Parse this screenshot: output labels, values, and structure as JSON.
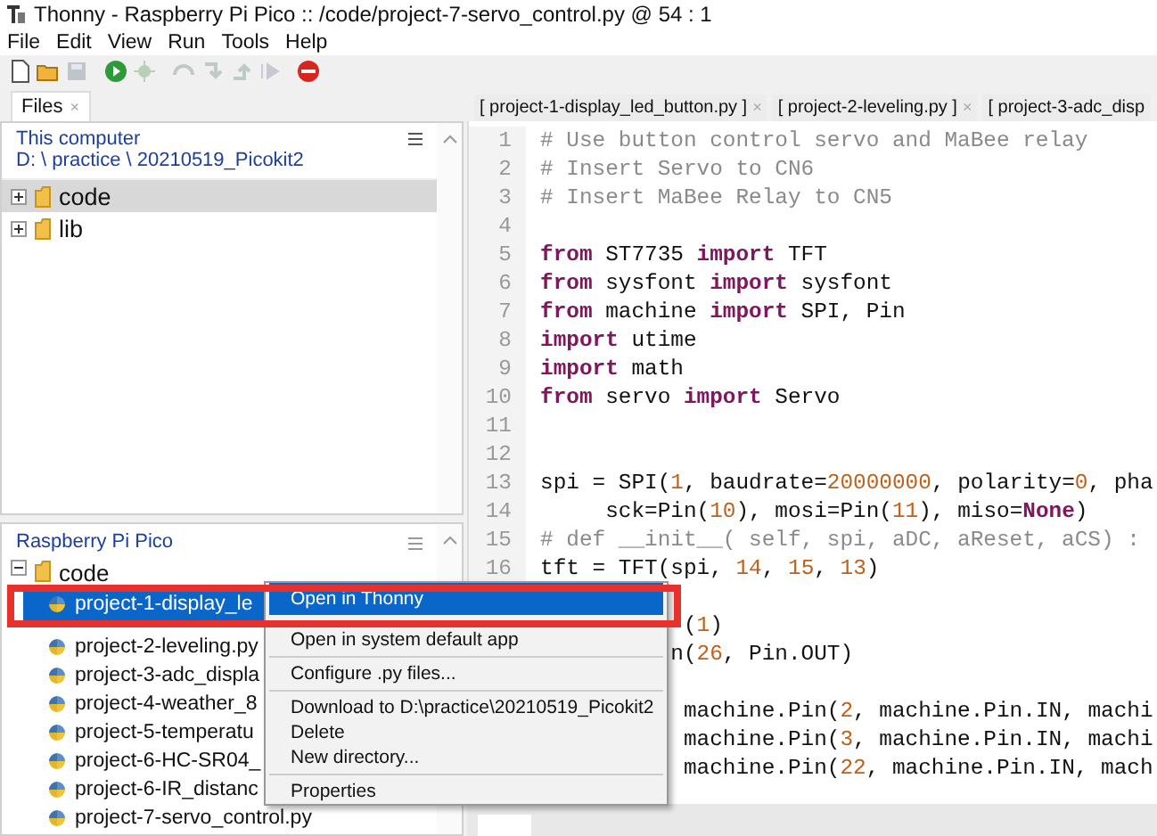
{
  "window": {
    "title": "Thonny  -  Raspberry Pi Pico :: /code/project-7-servo_control.py  @  54 : 1"
  },
  "menu_bar": [
    "File",
    "Edit",
    "View",
    "Run",
    "Tools",
    "Help"
  ],
  "toolbar": [
    {
      "kind": "new",
      "disabled": false
    },
    {
      "kind": "open",
      "disabled": false
    },
    {
      "kind": "save",
      "disabled": true
    },
    {
      "kind": "run",
      "disabled": false
    },
    {
      "kind": "debug",
      "disabled": true
    },
    {
      "kind": "step_over",
      "disabled": true
    },
    {
      "kind": "step_into",
      "disabled": true
    },
    {
      "kind": "step_out",
      "disabled": true
    },
    {
      "kind": "resume",
      "disabled": true
    },
    {
      "kind": "stop",
      "disabled": false
    }
  ],
  "files_tab": {
    "label": "Files",
    "close": "×"
  },
  "local_pane": {
    "title": "This computer",
    "path": "D: \\ practice \\ 20210519_Picokit2",
    "items": [
      {
        "name": "code",
        "expanded": false,
        "selected": true
      },
      {
        "name": "lib",
        "expanded": false,
        "selected": false
      }
    ]
  },
  "device_pane": {
    "title": "Raspberry Pi Pico",
    "folder": {
      "name": "code",
      "expanded": true,
      "selected": false
    },
    "files": [
      {
        "name": "project-1-display_le",
        "selected": true
      },
      {
        "name": "project-2-leveling.py",
        "selected": false
      },
      {
        "name": "project-3-adc_displa",
        "selected": false
      },
      {
        "name": "project-4-weather_8",
        "selected": false
      },
      {
        "name": "project-5-temperatu",
        "selected": false
      },
      {
        "name": "project-6-HC-SR04_",
        "selected": false
      },
      {
        "name": "project-6-IR_distanc",
        "selected": false
      },
      {
        "name": "project-7-servo_control.py",
        "selected": false
      }
    ]
  },
  "editor_tabs": [
    {
      "label": "[ project-1-display_led_button.py ]",
      "close": "×",
      "selected": false
    },
    {
      "label": "[ project-2-leveling.py ]",
      "close": "×",
      "selected": false
    },
    {
      "label": "[ project-3-adc_disp",
      "selected": false
    }
  ],
  "code_lines": [
    {
      "number": "1",
      "segments": [
        {
          "kind": "comment",
          "text": "# Use button control servo and MaBee relay"
        }
      ]
    },
    {
      "number": "2",
      "segments": [
        {
          "kind": "comment",
          "text": "# Insert Servo to CN6"
        }
      ]
    },
    {
      "number": "3",
      "segments": [
        {
          "kind": "comment",
          "text": "# Insert MaBee Relay to CN5"
        }
      ]
    },
    {
      "number": "4"
    },
    {
      "number": "5",
      "segments": [
        {
          "kind": "keyword",
          "text": "from"
        },
        {
          "kind": "plain",
          "text": " ST7735 "
        },
        {
          "kind": "keyword",
          "text": "import"
        },
        {
          "kind": "plain",
          "text": " TFT"
        }
      ]
    },
    {
      "number": "6",
      "segments": [
        {
          "kind": "keyword",
          "text": "from"
        },
        {
          "kind": "plain",
          "text": " sysfont "
        },
        {
          "kind": "keyword",
          "text": "import"
        },
        {
          "kind": "plain",
          "text": " sysfont"
        }
      ]
    },
    {
      "number": "7",
      "segments": [
        {
          "kind": "keyword",
          "text": "from"
        },
        {
          "kind": "plain",
          "text": " machine "
        },
        {
          "kind": "keyword",
          "text": "import"
        },
        {
          "kind": "plain",
          "text": " SPI, Pin"
        }
      ]
    },
    {
      "number": "8",
      "segments": [
        {
          "kind": "keyword",
          "text": "import"
        },
        {
          "kind": "plain",
          "text": " utime"
        }
      ]
    },
    {
      "number": "9",
      "segments": [
        {
          "kind": "keyword",
          "text": "import"
        },
        {
          "kind": "plain",
          "text": " math"
        }
      ]
    },
    {
      "number": "10",
      "segments": [
        {
          "kind": "keyword",
          "text": "from"
        },
        {
          "kind": "plain",
          "text": " servo "
        },
        {
          "kind": "keyword",
          "text": "import"
        },
        {
          "kind": "plain",
          "text": " Servo"
        }
      ]
    },
    {
      "number": "11"
    },
    {
      "number": "12"
    },
    {
      "number": "13",
      "segments": [
        {
          "kind": "plain",
          "text": "spi = SPI("
        },
        {
          "kind": "number",
          "text": "1"
        },
        {
          "kind": "plain",
          "text": ", baudrate="
        },
        {
          "kind": "number",
          "text": "20000000"
        },
        {
          "kind": "plain",
          "text": ", polarity="
        },
        {
          "kind": "number",
          "text": "0"
        },
        {
          "kind": "plain",
          "text": ", pha"
        }
      ]
    },
    {
      "number": "14",
      "segments": [
        {
          "kind": "plain",
          "text": "     sck=Pin("
        },
        {
          "kind": "number",
          "text": "10"
        },
        {
          "kind": "plain",
          "text": "), mosi=Pin("
        },
        {
          "kind": "number",
          "text": "11"
        },
        {
          "kind": "plain",
          "text": "), miso="
        },
        {
          "kind": "keyword",
          "text": "None"
        },
        {
          "kind": "plain",
          "text": ")"
        }
      ]
    },
    {
      "number": "15",
      "segments": [
        {
          "kind": "comment",
          "text": "# def __init__( self, spi, aDC, aReset, aCS) :"
        }
      ]
    },
    {
      "number": "16",
      "segments": [
        {
          "kind": "plain",
          "text": "tft = TFT(spi, "
        },
        {
          "kind": "number",
          "text": "14"
        },
        {
          "kind": "plain",
          "text": ", "
        },
        {
          "kind": "number",
          "text": "15"
        },
        {
          "kind": "plain",
          "text": ", "
        },
        {
          "kind": "number",
          "text": "13"
        },
        {
          "kind": "plain",
          "text": ")"
        }
      ]
    },
    {
      "segments": [
        {
          "kind": "plain",
          "text": "           ("
        },
        {
          "kind": "number",
          "text": "1"
        },
        {
          "kind": "plain",
          "text": ")"
        }
      ]
    },
    {
      "segments": [
        {
          "kind": "plain",
          "text": "          n("
        },
        {
          "kind": "number",
          "text": "26"
        },
        {
          "kind": "plain",
          "text": ", Pin.OUT)"
        }
      ]
    },
    {
      "segments": [
        {
          "kind": "plain",
          "text": "           machine.Pin("
        },
        {
          "kind": "number",
          "text": "2"
        },
        {
          "kind": "plain",
          "text": ", machine.Pin.IN, machi"
        }
      ]
    },
    {
      "segments": [
        {
          "kind": "plain",
          "text": "           machine.Pin("
        },
        {
          "kind": "number",
          "text": "3"
        },
        {
          "kind": "plain",
          "text": ", machine.Pin.IN, machi"
        }
      ]
    },
    {
      "segments": [
        {
          "kind": "plain",
          "text": "           machine.Pin("
        },
        {
          "kind": "number",
          "text": "22"
        },
        {
          "kind": "plain",
          "text": ", machine.Pin.IN, mach"
        }
      ]
    }
  ],
  "context_menu": {
    "groups": [
      [
        {
          "label": "Open in Thonny",
          "selected": true
        },
        {
          "label": "Open in system default app",
          "selected": false
        }
      ],
      [
        {
          "label": "Configure .py files...",
          "selected": false
        }
      ],
      [
        {
          "label": "Download to D:\\practice\\20210519_Picokit2",
          "selected": false
        },
        {
          "label": "Delete",
          "selected": false
        },
        {
          "label": "New directory...",
          "selected": false
        }
      ],
      [
        {
          "label": "Properties",
          "selected": false
        }
      ]
    ]
  }
}
